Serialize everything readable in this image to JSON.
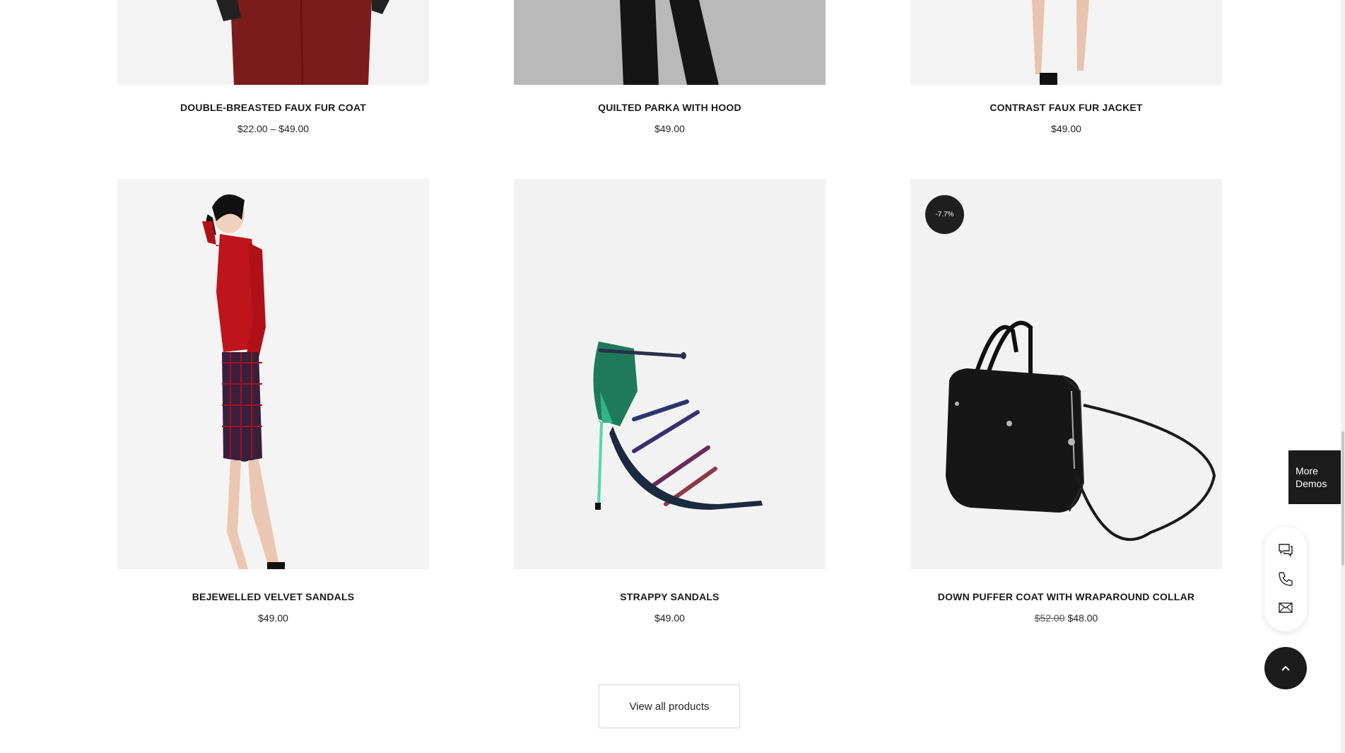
{
  "products": [
    {
      "title": "DOUBLE-BREASTED FAUX FUR COAT",
      "price": "$22.00 – $49.00"
    },
    {
      "title": "QUILTED PARKA WITH HOOD",
      "price": "$49.00"
    },
    {
      "title": "CONTRAST FAUX FUR JACKET",
      "price": "$49.00"
    },
    {
      "title": "BEJEWELLED VELVET SANDALS",
      "price": "$49.00"
    },
    {
      "title": "STRAPPY SANDALS",
      "price": "$49.00"
    },
    {
      "title": "DOWN PUFFER COAT WITH WRAPAROUND COLLAR",
      "old_price": "$52.00",
      "price": "$48.00",
      "badge": "-7.7%"
    }
  ],
  "view_all_label": "View all products",
  "more_demos_label": "More Demos",
  "colors": {
    "dark": "#1c1c1c",
    "image_bg": "#f2f2f2"
  }
}
